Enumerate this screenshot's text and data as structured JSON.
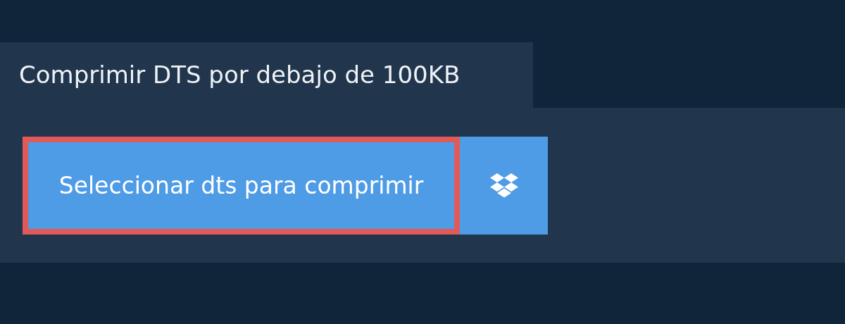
{
  "tab": {
    "title": "Comprimir DTS por debajo de 100KB"
  },
  "upload_button": {
    "label": "Seleccionar dts para comprimir",
    "highlighted": true
  }
}
